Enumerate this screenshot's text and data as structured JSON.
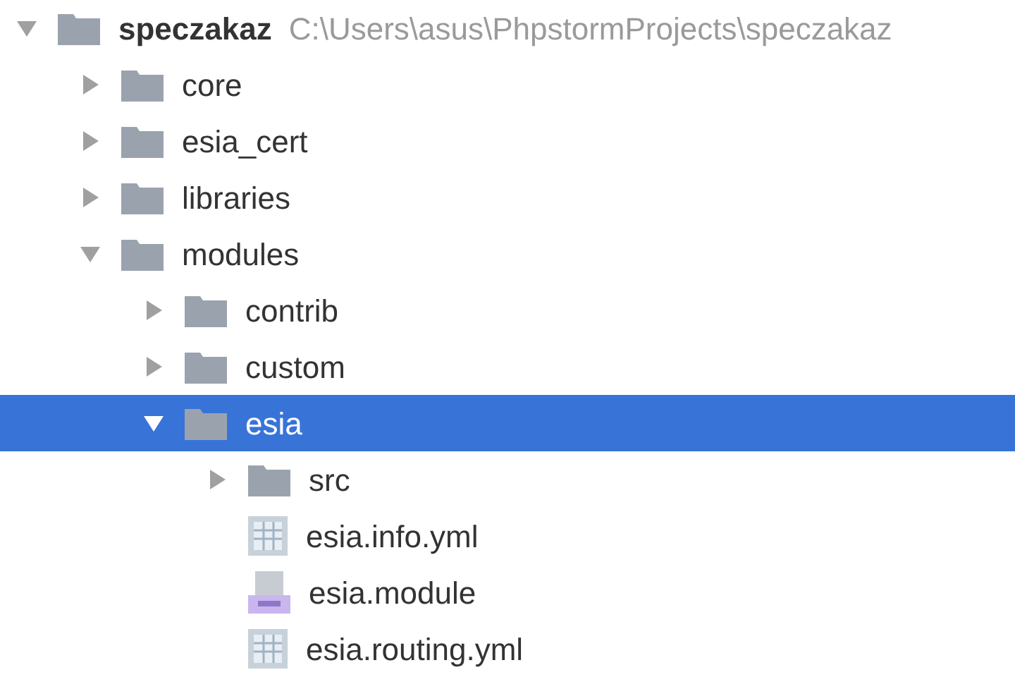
{
  "tree": [
    {
      "kind": "folder",
      "name": "speczakaz",
      "path": "C:\\Users\\asus\\PhpstormProjects\\speczakaz",
      "expanded": true,
      "selected": false,
      "children": [
        {
          "kind": "folder",
          "name": "core",
          "expanded": false,
          "selected": false
        },
        {
          "kind": "folder",
          "name": "esia_cert",
          "expanded": false,
          "selected": false
        },
        {
          "kind": "folder",
          "name": "libraries",
          "expanded": false,
          "selected": false
        },
        {
          "kind": "folder",
          "name": "modules",
          "expanded": true,
          "selected": false,
          "children": [
            {
              "kind": "folder",
              "name": "contrib",
              "expanded": false,
              "selected": false
            },
            {
              "kind": "folder",
              "name": "custom",
              "expanded": false,
              "selected": false
            },
            {
              "kind": "folder",
              "name": "esia",
              "expanded": true,
              "selected": true,
              "children": [
                {
                  "kind": "folder",
                  "name": "src",
                  "expanded": false,
                  "selected": false
                },
                {
                  "kind": "yml",
                  "name": "esia.info.yml",
                  "selected": false
                },
                {
                  "kind": "php",
                  "name": "esia.module",
                  "selected": false
                },
                {
                  "kind": "yml",
                  "name": "esia.routing.yml",
                  "selected": false
                }
              ]
            }
          ]
        }
      ]
    }
  ]
}
